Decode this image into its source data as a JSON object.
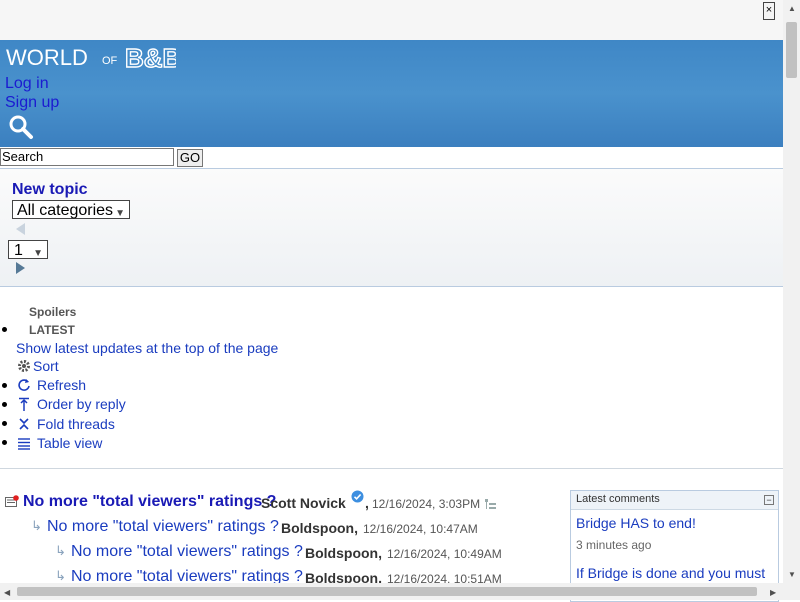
{
  "window": {
    "close_label": "×"
  },
  "header": {
    "logo_text_world": "WORLD",
    "logo_text_of": "OF",
    "logo_text_bb": "B&B",
    "login_label": "Log in",
    "signup_label": "Sign up",
    "search_icon": "search-icon",
    "brand_color": "#3f87c6"
  },
  "search": {
    "value": "Search",
    "go_label": "GO"
  },
  "forum_controls": {
    "new_topic_label": "New topic",
    "category_selected": "All categories",
    "page_selected": "1"
  },
  "options": {
    "spoilers_label": "Spoilers",
    "latest_label": "LATEST",
    "latest_desc": "Show latest updates at the top of the page",
    "sort_label": "Sort",
    "refresh_label": "Refresh",
    "order_label": "Order by reply",
    "fold_label": "Fold threads",
    "table_label": "Table view"
  },
  "threads": [
    {
      "title": "No more \"total viewers\" ratings ?",
      "author": "Scott Novick",
      "date": "12/16/2024, 3:03PM",
      "level": 0,
      "verified": true
    },
    {
      "title": "No more \"total viewers\" ratings ?",
      "author": "Boldspoon",
      "date": "12/16/2024, 10:47AM",
      "level": 1
    },
    {
      "title": "No more \"total viewers\" ratings ?",
      "author": "Boldspoon",
      "date": "12/16/2024, 10:49AM",
      "level": 2
    },
    {
      "title": "No more \"total viewers\" ratings ?",
      "author": "Boldspoon",
      "date": "12/16/2024, 10:51AM",
      "level": 2
    }
  ],
  "latest_comments": {
    "title": "Latest comments",
    "items": [
      {
        "text": "Bridge HAS to end!",
        "time": "3 minutes ago"
      },
      {
        "text": "If Bridge is done and you must",
        "time": ""
      }
    ]
  }
}
